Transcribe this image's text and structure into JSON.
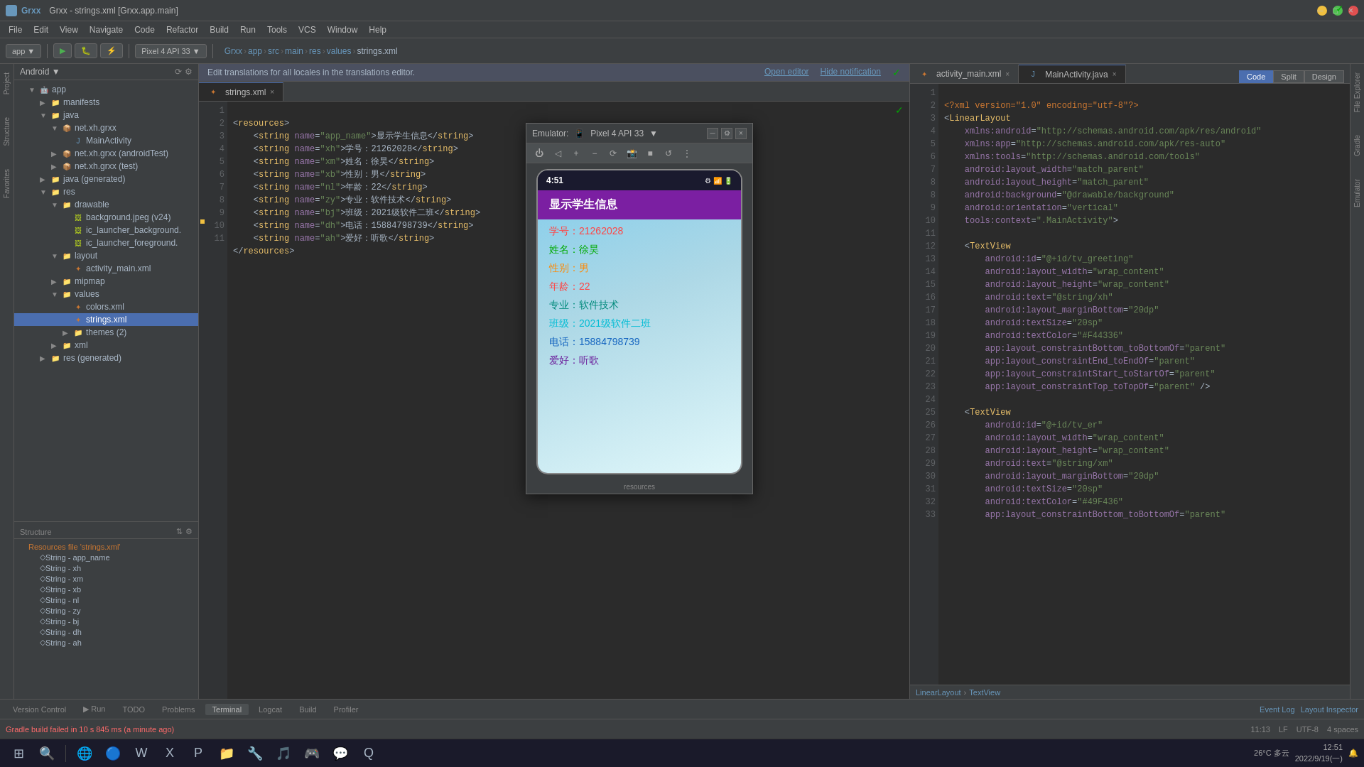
{
  "window": {
    "title": "Grxx - strings.xml [Grxx.app.main]",
    "app_name": "Grxx"
  },
  "menubar": {
    "items": [
      "File",
      "Edit",
      "View",
      "Navigate",
      "Code",
      "Refactor",
      "Build",
      "Run",
      "Tools",
      "VCS",
      "Window",
      "Help"
    ]
  },
  "toolbar": {
    "app_module": "app",
    "device": "Pixel 4 API 33",
    "breadcrumb": [
      "Grxx",
      "app",
      "src",
      "main",
      "res",
      "values",
      "strings.xml"
    ]
  },
  "notification": {
    "message": "Edit translations for all locales in the translations editor.",
    "open_editor": "Open editor",
    "hide": "Hide notification"
  },
  "editor_tabs": [
    {
      "label": "strings.xml",
      "active": true
    },
    {
      "label": "activity_main.xml",
      "active": false
    },
    {
      "label": "MainActivity.java",
      "active": false
    }
  ],
  "strings_xml": {
    "lines": [
      {
        "num": 1,
        "content": "<resources>"
      },
      {
        "num": 2,
        "content": "    <string name=\"app_name\">显示学生信息</string>"
      },
      {
        "num": 3,
        "content": "    <string name=\"xh\">学号：21262028</string>"
      },
      {
        "num": 4,
        "content": "    <string name=\"xm\">姓名：徐昊</string>"
      },
      {
        "num": 5,
        "content": "    <string name=\"xb\">性别：男</string>"
      },
      {
        "num": 6,
        "content": "    <string name=\"nl\">年龄：22</string>"
      },
      {
        "num": 7,
        "content": "    <string name=\"zy\">专业：软件技术</string>"
      },
      {
        "num": 8,
        "content": "    <string name=\"bj\">班级：2021级软件二班</string>"
      },
      {
        "num": 9,
        "content": "    <string name=\"dh\">电话：15884798739</string>"
      },
      {
        "num": 10,
        "content": "    <string name=\"ah\">爱好：听歌</string>"
      },
      {
        "num": 11,
        "content": "</resources>"
      }
    ]
  },
  "activity_xml": {
    "lines": [
      {
        "num": 1,
        "content": "<?xml version=\"1.0\" encoding=\"utf-8\"?>"
      },
      {
        "num": 2,
        "content": "<LinearLayout"
      },
      {
        "num": 3,
        "content": "    xmlns:android=\"http://schemas.android.com/apk/res/android\""
      },
      {
        "num": 4,
        "content": "    xmlns:app=\"http://schemas.android.com/apk/res-auto\""
      },
      {
        "num": 5,
        "content": "    xmlns:tools=\"http://schemas.android.com/tools\""
      },
      {
        "num": 6,
        "content": "    android:layout_width=\"match_parent\""
      },
      {
        "num": 7,
        "content": "    android:layout_height=\"match_parent\""
      },
      {
        "num": 8,
        "content": "    android:background=\"@drawable/background\""
      },
      {
        "num": 9,
        "content": "    android:orientation=\"vertical\""
      },
      {
        "num": 10,
        "content": "    tools:context=\".MainActivity\">"
      },
      {
        "num": 11,
        "content": ""
      },
      {
        "num": 12,
        "content": "    <TextView"
      },
      {
        "num": 13,
        "content": "        android:id=\"@+id/tv_greeting\""
      },
      {
        "num": 14,
        "content": "        android:layout_width=\"wrap_content\""
      },
      {
        "num": 15,
        "content": "        android:layout_height=\"wrap_content\""
      },
      {
        "num": 16,
        "content": "        android:text=\"@string/xh\""
      },
      {
        "num": 17,
        "content": "        android:layout_marginBottom=\"20dp\""
      },
      {
        "num": 18,
        "content": "        android:textSize=\"20sp\""
      },
      {
        "num": 19,
        "content": "        android:textColor=\"#F44336\""
      },
      {
        "num": 20,
        "content": "        app:layout_constraintBottom_toBottomOf=\"parent\""
      },
      {
        "num": 21,
        "content": "        app:layout_constraintEnd_toEndOf=\"parent\""
      },
      {
        "num": 22,
        "content": "        app:layout_constraintStart_toStartOf=\"parent\""
      },
      {
        "num": 23,
        "content": "        app:layout_constraintTop_toTopOf=\"parent\" />"
      },
      {
        "num": 24,
        "content": ""
      },
      {
        "num": 25,
        "content": "    <TextView"
      },
      {
        "num": 26,
        "content": "        android:id=\"@+id/tv_er\""
      },
      {
        "num": 27,
        "content": "        android:layout_width=\"wrap_content\""
      },
      {
        "num": 28,
        "content": "        android:layout_height=\"wrap_content\""
      },
      {
        "num": 29,
        "content": "        android:text=\"@string/xm\""
      },
      {
        "num": 30,
        "content": "        android:layout_marginBottom=\"20dp\""
      },
      {
        "num": 31,
        "content": "        android:textSize=\"20sp\""
      },
      {
        "num": 32,
        "content": "        android:textColor=\"#49F436\""
      },
      {
        "num": 33,
        "content": "        app:layout_constraintBottom_toBottomOf=\"parent\""
      }
    ]
  },
  "project_tree": {
    "items": [
      {
        "label": "Android",
        "type": "dropdown",
        "indent": 0
      },
      {
        "label": "app",
        "type": "folder-open",
        "indent": 1
      },
      {
        "label": "manifests",
        "type": "folder-open",
        "indent": 2
      },
      {
        "label": "java",
        "type": "folder-open",
        "indent": 2
      },
      {
        "label": "net.xh.grxx",
        "type": "folder-open",
        "indent": 3
      },
      {
        "label": "MainActivity",
        "type": "java",
        "indent": 4
      },
      {
        "label": "net.xh.grxx (androidTest)",
        "type": "folder-open",
        "indent": 3
      },
      {
        "label": "net.xh.grxx (test)",
        "type": "folder-open",
        "indent": 3
      },
      {
        "label": "java (generated)",
        "type": "folder-open",
        "indent": 2
      },
      {
        "label": "res",
        "type": "folder-open",
        "indent": 2
      },
      {
        "label": "drawable",
        "type": "folder-open",
        "indent": 3
      },
      {
        "label": "background.jpeg (v24)",
        "type": "image",
        "indent": 4
      },
      {
        "label": "ic_launcher_background.",
        "type": "image",
        "indent": 4
      },
      {
        "label": "ic_launcher_foreground.",
        "type": "image",
        "indent": 4
      },
      {
        "label": "layout",
        "type": "folder-open",
        "indent": 3
      },
      {
        "label": "activity_main.xml",
        "type": "xml",
        "indent": 4
      },
      {
        "label": "mipmap",
        "type": "folder-open",
        "indent": 3
      },
      {
        "label": "values",
        "type": "folder-open",
        "indent": 3
      },
      {
        "label": "colors.xml",
        "type": "xml",
        "indent": 4
      },
      {
        "label": "strings.xml",
        "type": "xml-active",
        "indent": 4
      },
      {
        "label": "themes (2)",
        "type": "folder-open",
        "indent": 4
      },
      {
        "label": "xml",
        "type": "folder-open",
        "indent": 3
      },
      {
        "label": "res (generated)",
        "type": "folder-open",
        "indent": 2
      }
    ]
  },
  "structure": {
    "title": "Structure",
    "items": [
      {
        "label": "Resources file 'strings.xml'",
        "type": "resource",
        "indent": 0
      },
      {
        "label": "String - app_name",
        "type": "string",
        "indent": 1
      },
      {
        "label": "String - xh",
        "type": "string",
        "indent": 1
      },
      {
        "label": "String - xm",
        "type": "string",
        "indent": 1
      },
      {
        "label": "String - xb",
        "type": "string",
        "indent": 1
      },
      {
        "label": "String - nl",
        "type": "string",
        "indent": 1
      },
      {
        "label": "String - zy",
        "type": "string",
        "indent": 1
      },
      {
        "label": "String - bj",
        "type": "string",
        "indent": 1
      },
      {
        "label": "String - dh",
        "type": "string",
        "indent": 1
      },
      {
        "label": "String - ah",
        "type": "string",
        "indent": 1
      }
    ]
  },
  "emulator": {
    "title": "Emulator:",
    "device": "Pixel 4 API 33",
    "phone": {
      "time": "4:51",
      "appbar": "显示学生信息",
      "data": [
        {
          "label": "学号：21262028",
          "color": "red"
        },
        {
          "label": "姓名：徐昊",
          "color": "green"
        },
        {
          "label": "性别：男",
          "color": "orange"
        },
        {
          "label": "年龄：22",
          "color": "red"
        },
        {
          "label": "专业：软件技术",
          "color": "teal"
        },
        {
          "label": "班级：2021级软件二班",
          "color": "cyan"
        },
        {
          "label": "电话：15884798739",
          "color": "blue"
        },
        {
          "label": "爱好：听歌",
          "color": "purple"
        }
      ]
    }
  },
  "bottom_tabs": {
    "items": [
      "Version Control",
      "Run",
      "TODO",
      "Problems",
      "Terminal",
      "Logcat",
      "Build",
      "Profiler"
    ]
  },
  "statusbar": {
    "build_status": "Gradle build failed in 10 s 845 ms (a minute ago)",
    "line": "11:13",
    "lf": "LF",
    "encoding": "UTF-8",
    "indent": "4 spaces",
    "layout_inspector": "Layout Inspector",
    "event_log": "Event Log",
    "breadcrumb": "LinearLayout > TextView"
  },
  "far_left_panels": [
    "Project",
    "Structure",
    "Favorites"
  ],
  "far_right_panels": [
    "File Explorer",
    "Gradle",
    "Emulator"
  ],
  "taskbar": {
    "time": "12:51",
    "date": "2022/9/19(一)",
    "weather": "26°C 多云"
  },
  "view_modes": {
    "code": "Code",
    "split": "Split",
    "design": "Design"
  }
}
